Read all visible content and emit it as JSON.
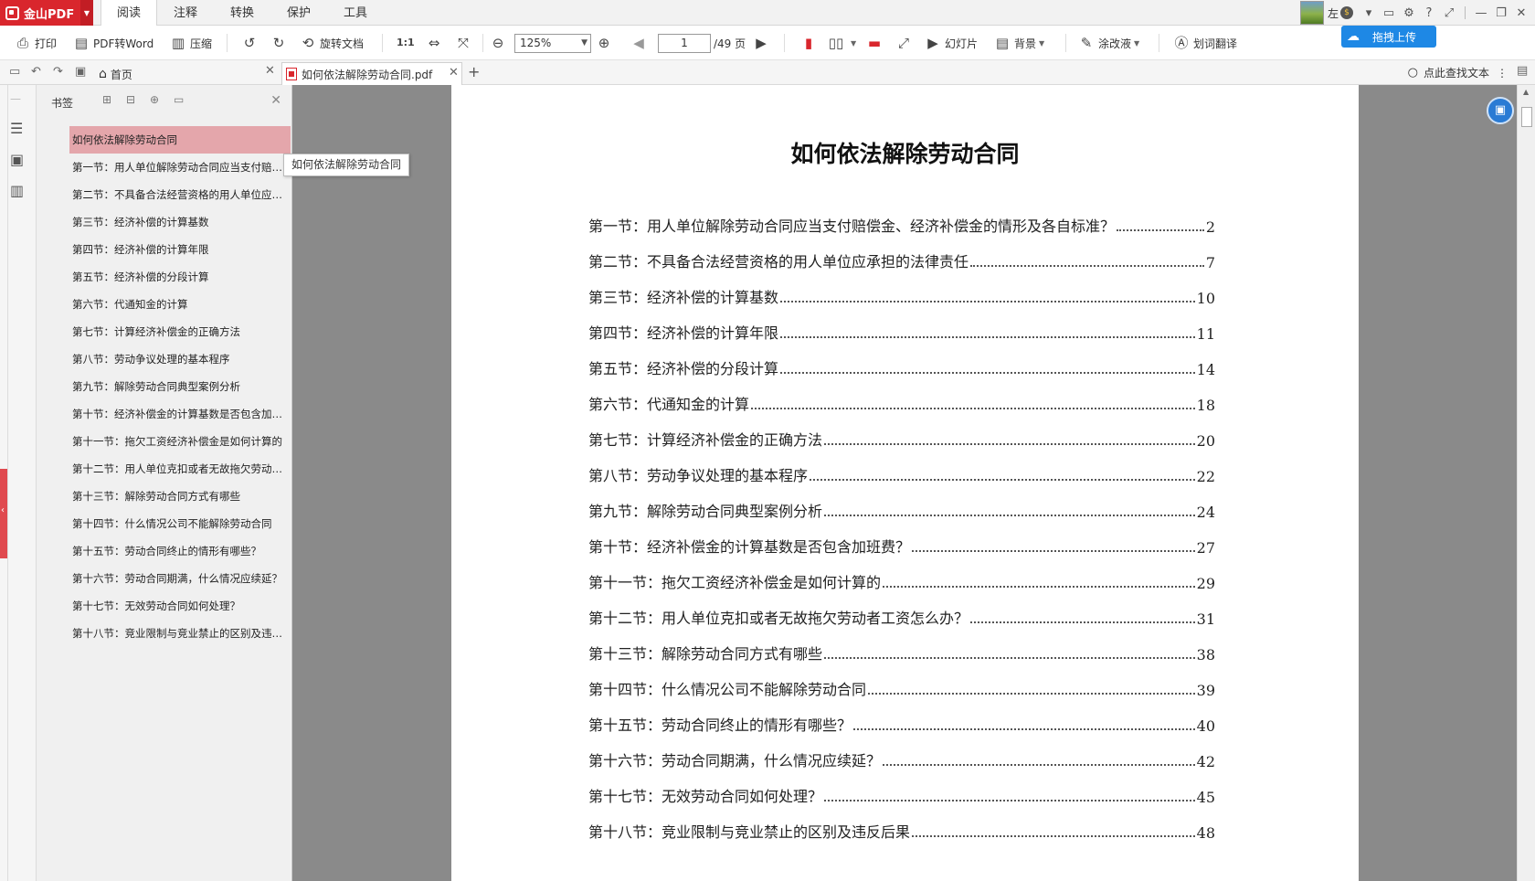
{
  "app": {
    "name": "金山PDF",
    "menu_tabs": [
      "阅读",
      "注释",
      "转换",
      "保护",
      "工具"
    ],
    "active_tab": "阅读",
    "user_label": "左",
    "upload_label": "拖拽上传"
  },
  "toolbar": {
    "print": "打印",
    "pdf_to_word": "PDF转Word",
    "compress": "压缩",
    "rotate_doc": "旋转文档",
    "zoom": "125%",
    "page_current": "1",
    "page_total": "/49 页",
    "slideshow": "幻灯片",
    "background": "背景",
    "correction": "涂改液",
    "translate": "划词翻译"
  },
  "tabs": {
    "home": "首页",
    "document": "如何依法解除劳动合同.pdf",
    "find": "点此查找文本"
  },
  "bookmarks": {
    "title": "书签",
    "tooltip": "如何依法解除劳动合同",
    "items": [
      "如何依法解除劳动合同",
      "第一节：用人单位解除劳动合同应当支付赔偿金、经济补偿金的情形及各自标准？",
      "第二节：不具备合法经营资格的用人单位应承担的法律责任",
      "第三节：经济补偿的计算基数",
      "第四节：经济补偿的计算年限",
      "第五节：经济补偿的分段计算",
      "第六节：代通知金的计算",
      "第七节：计算经济补偿金的正确方法",
      "第八节：劳动争议处理的基本程序",
      "第九节：解除劳动合同典型案例分析",
      "第十节：经济补偿金的计算基数是否包含加班费？",
      "第十一节：拖欠工资经济补偿金是如何计算的",
      "第十二节：用人单位克扣或者无故拖欠劳动者工资怎么办？",
      "第十三节：解除劳动合同方式有哪些",
      "第十四节：什么情况公司不能解除劳动合同",
      "第十五节：劳动合同终止的情形有哪些？",
      "第十六节：劳动合同期满，什么情况应续延？",
      "第十七节：无效劳动合同如何处理？",
      "第十八节：竞业限制与竞业禁止的区别及违反后果"
    ]
  },
  "document": {
    "title": "如何依法解除劳动合同",
    "toc": [
      {
        "text": "第一节：用人单位解除劳动合同应当支付赔偿金、经济补偿金的情形及各自标准？",
        "page": "2"
      },
      {
        "text": "第二节：不具备合法经营资格的用人单位应承担的法律责任",
        "page": "7"
      },
      {
        "text": "第三节：经济补偿的计算基数",
        "page": "10"
      },
      {
        "text": "第四节：经济补偿的计算年限",
        "page": "11"
      },
      {
        "text": "第五节：经济补偿的分段计算",
        "page": "14"
      },
      {
        "text": "第六节：代通知金的计算",
        "page": "18"
      },
      {
        "text": "第七节：计算经济补偿金的正确方法",
        "page": "20"
      },
      {
        "text": "第八节：劳动争议处理的基本程序",
        "page": "22"
      },
      {
        "text": "第九节：解除劳动合同典型案例分析",
        "page": "24"
      },
      {
        "text": "第十节：经济补偿金的计算基数是否包含加班费？",
        "page": "27"
      },
      {
        "text": "第十一节：拖欠工资经济补偿金是如何计算的",
        "page": "29"
      },
      {
        "text": "第十二节：用人单位克扣或者无故拖欠劳动者工资怎么办？",
        "page": "31"
      },
      {
        "text": "第十三节：解除劳动合同方式有哪些",
        "page": "38"
      },
      {
        "text": "第十四节：什么情况公司不能解除劳动合同",
        "page": "39"
      },
      {
        "text": "第十五节：劳动合同终止的情形有哪些？",
        "page": "40"
      },
      {
        "text": "第十六节：劳动合同期满，什么情况应续延？",
        "page": "42"
      },
      {
        "text": "第十七节：无效劳动合同如何处理？",
        "page": "45"
      },
      {
        "text": "第十八节：竞业限制与竞业禁止的区别及违反后果",
        "page": "48"
      }
    ]
  },
  "colors": {
    "brand": "#d9262d",
    "selection": "#e4a6ab",
    "accent": "#1e88e5"
  }
}
